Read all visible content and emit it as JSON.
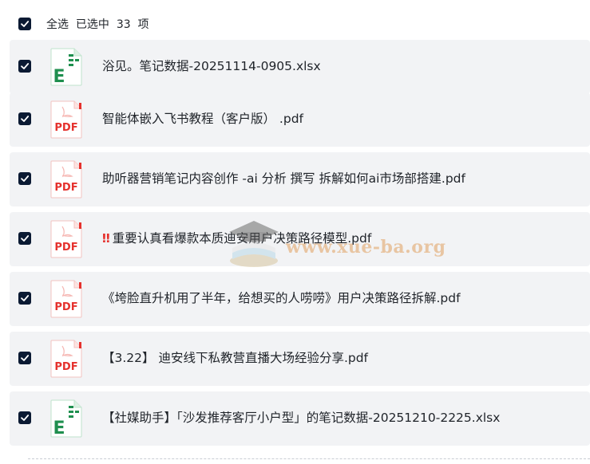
{
  "select_all": {
    "label": "全选",
    "selected_prefix": "已选中",
    "count": "33",
    "suffix": "项",
    "checked": true
  },
  "files": [
    {
      "type": "xlsx",
      "icon": "excel-icon",
      "name": "浴见。笔记数据-20251114-0905.xlsx",
      "checked": true
    },
    {
      "type": "pdf",
      "icon": "pdf-icon",
      "name": "智能体嵌入飞书教程（客户版） .pdf",
      "checked": true
    },
    {
      "type": "pdf",
      "icon": "pdf-icon",
      "name": "助听器营销笔记内容创作 -ai 分析 撰写 拆解如何ai市场部搭建.pdf",
      "checked": true
    },
    {
      "type": "pdf",
      "icon": "pdf-icon",
      "mark": "‼",
      "name": "重要认真看爆款本质迪安用户决策路径模型.pdf",
      "checked": true
    },
    {
      "type": "pdf",
      "icon": "pdf-icon",
      "name": "《垮脸直升机用了半年，给想买的人唠唠》用户决策路径拆解.pdf",
      "checked": true
    },
    {
      "type": "pdf",
      "icon": "pdf-icon",
      "name": "【3.22】 迪安线下私教营直播大场经验分享.pdf",
      "checked": true
    },
    {
      "type": "xlsx",
      "icon": "excel-icon",
      "name": "【社媒助手】「沙发推荐客厅小户型」的笔记数据-20251210-2225.xlsx",
      "checked": true
    }
  ],
  "watermark": {
    "text": "www.xue-ba.org"
  },
  "colors": {
    "checkbox_fill": "#0b1a33",
    "row_bg": "#f2f3f5",
    "pdf_red": "#e5312d",
    "excel_green": "#1e8f4e"
  }
}
